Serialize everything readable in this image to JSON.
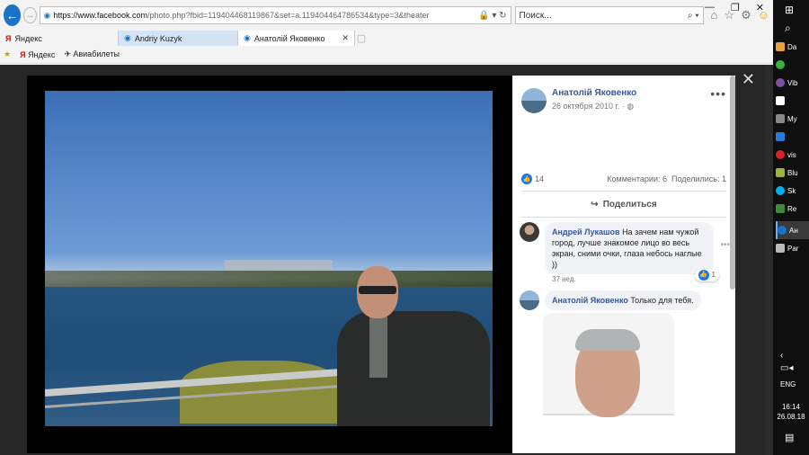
{
  "browser": {
    "address_host": "https://www.facebook.com",
    "address_path": "/photo.php?fbid=119404468119867&set=a.119404464786534&type=3&theater",
    "search_placeholder": "Поиск...",
    "tabs": [
      {
        "label": "Яндекс"
      },
      {
        "label": "Andriy Kuzyk"
      },
      {
        "label": "Анатолій Яковенко"
      }
    ],
    "favorites": [
      {
        "label": "Яндекс"
      },
      {
        "label": "Авиабилеты"
      }
    ]
  },
  "post": {
    "author": "Анатолій Яковенко",
    "date": "26 октября 2010 г. · ",
    "likes": "14",
    "comments_count": "Комментарии: 6",
    "shares_count": "Поделились: 1",
    "share_button": "Поделиться"
  },
  "comments": [
    {
      "author": "Андрей Лукашов",
      "text": "На зачем нам чужой город, лучше знакомое лицо во весь экран, сними очки, глаза небось наглые ))",
      "reactions": "1",
      "time": "37 нед."
    },
    {
      "author": "Анатолій Яковенко",
      "text": "Только для тебя."
    }
  ],
  "taskbar": {
    "items": [
      {
        "label": "Da"
      },
      {
        "label": ""
      },
      {
        "label": "Vib"
      },
      {
        "label": ""
      },
      {
        "label": "My"
      },
      {
        "label": ""
      },
      {
        "label": "vis"
      },
      {
        "label": "Blu"
      },
      {
        "label": "Sk"
      },
      {
        "label": "Re"
      },
      {
        "label": "Ан"
      },
      {
        "label": "Par"
      }
    ],
    "language": "ENG",
    "time": "16:14",
    "date": "26.08.18"
  },
  "colors": {
    "facebook_link": "#385898",
    "like_blue": "#1877f2",
    "ie_blue": "#1a73c8"
  }
}
